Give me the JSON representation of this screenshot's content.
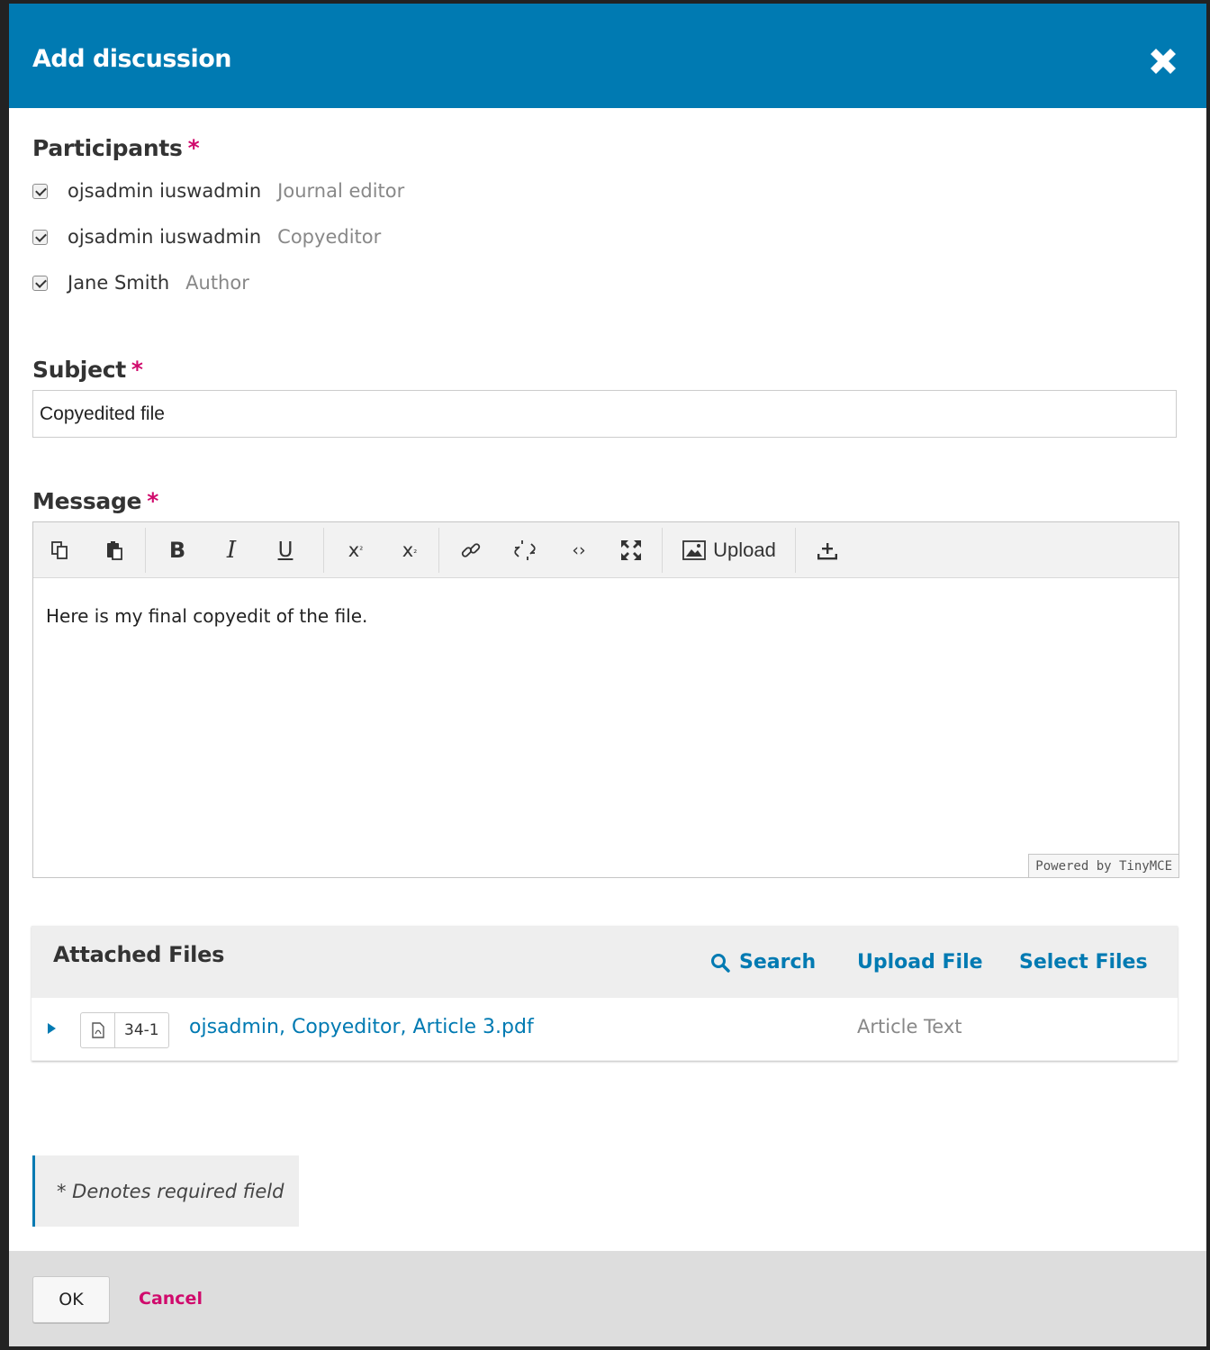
{
  "modal": {
    "title": "Add discussion"
  },
  "participants": {
    "label": "Participants",
    "required_mark": "*",
    "items": [
      {
        "name": "ojsadmin iuswadmin",
        "role": "Journal editor",
        "checked": true
      },
      {
        "name": "ojsadmin iuswadmin",
        "role": "Copyeditor",
        "checked": true
      },
      {
        "name": "Jane Smith",
        "role": "Author",
        "checked": true
      }
    ]
  },
  "subject": {
    "label": "Subject",
    "required_mark": "*",
    "value": "Copyedited file"
  },
  "message": {
    "label": "Message",
    "required_mark": "*",
    "toolbar": {
      "upload_label": "Upload"
    },
    "body": "Here is my final copyedit of the file.",
    "powered_by": "Powered by TinyMCE"
  },
  "attached_files": {
    "title": "Attached Files",
    "search_label": "Search",
    "upload_label": "Upload File",
    "select_label": "Select Files",
    "rows": [
      {
        "id": "34-1",
        "name": "ojsadmin, Copyeditor, Article 3.pdf",
        "type": "Article Text"
      }
    ]
  },
  "note": "* Denotes required field",
  "footer": {
    "ok_label": "OK",
    "cancel_label": "Cancel"
  },
  "colors": {
    "header": "#007ab2",
    "link": "#007ab2",
    "required": "#d00a6c"
  }
}
